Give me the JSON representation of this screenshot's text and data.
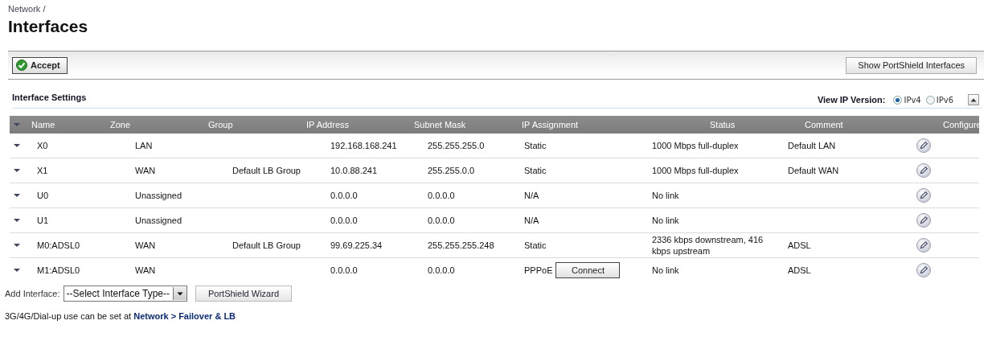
{
  "breadcrumb": "Network /",
  "title": "Interfaces",
  "toolbar": {
    "accept_button": "Accept",
    "portshield_button": "Show PortShield Interfaces"
  },
  "section": {
    "title": "Interface Settings",
    "ip_version": {
      "label": "View IP Version:",
      "options": [
        {
          "label": "IPv4",
          "selected": true
        },
        {
          "label": "IPv6",
          "selected": false
        }
      ]
    }
  },
  "table": {
    "columns": [
      "Name",
      "Zone",
      "Group",
      "IP Address",
      "Subnet Mask",
      "IP Assignment",
      "Status",
      "Comment",
      "Configure"
    ],
    "rows": [
      {
        "name": "X0",
        "zone": "LAN",
        "group": "",
        "ip": "192.168.168.241",
        "mask": "255.255.255.0",
        "assignment": "Static",
        "status": "1000 Mbps full-duplex",
        "comment": "Default LAN"
      },
      {
        "name": "X1",
        "zone": "WAN",
        "group": "Default LB Group",
        "ip": "10.0.88.241",
        "mask": "255.255.0.0",
        "assignment": "Static",
        "status": "1000 Mbps full-duplex",
        "comment": "Default WAN"
      },
      {
        "name": "U0",
        "zone": "Unassigned",
        "group": "",
        "ip": "0.0.0.0",
        "mask": "0.0.0.0",
        "assignment": "N/A",
        "status": "No link",
        "comment": ""
      },
      {
        "name": "U1",
        "zone": "Unassigned",
        "group": "",
        "ip": "0.0.0.0",
        "mask": "0.0.0.0",
        "assignment": "N/A",
        "status": "No link",
        "comment": ""
      },
      {
        "name": "M0:ADSL0",
        "zone": "WAN",
        "group": "Default LB Group",
        "ip": "99.69.225.34",
        "mask": "255.255.255.248",
        "assignment": "Static",
        "status": "2336 kbps downstream, 416 kbps upstream",
        "comment": "ADSL"
      },
      {
        "name": "M1:ADSL0",
        "zone": "WAN",
        "group": "",
        "ip": "0.0.0.0",
        "mask": "0.0.0.0",
        "assignment": "PPPoE",
        "connect_button": "Connect",
        "status": "No link",
        "comment": "ADSL"
      }
    ]
  },
  "add_interface": {
    "label": "Add Interface:",
    "select_value": "--Select Interface Type--",
    "wizard_button": "PortShield Wizard"
  },
  "note": {
    "text": "3G/4G/Dial-up use can be set at ",
    "link": "Network > Failover & LB"
  }
}
